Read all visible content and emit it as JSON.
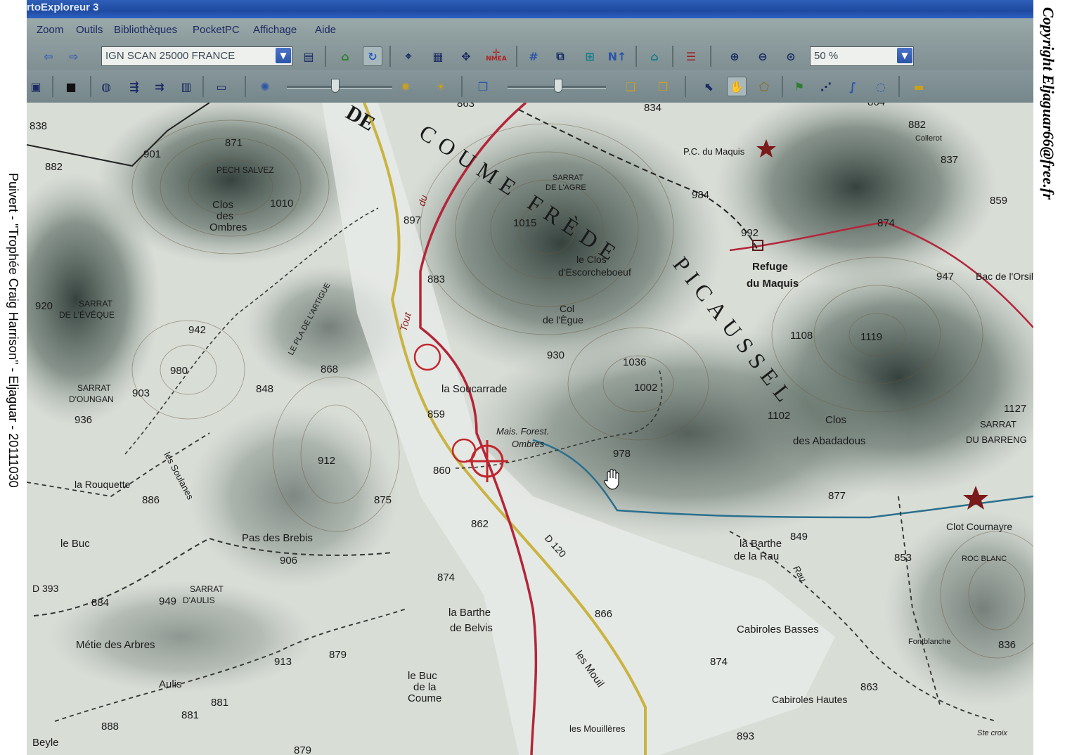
{
  "window": {
    "title": "rtoExploreur 3"
  },
  "menu": {
    "items": [
      "Zoom",
      "Outils",
      "Bibliothèques",
      "PocketPC",
      "Affichage",
      "Aide"
    ]
  },
  "toolbar": {
    "map_selector": {
      "value": "IGN SCAN 25000 FRANCE"
    },
    "zoom_selector": {
      "value": "50 %"
    },
    "nmea_label": "NMEA",
    "north_label": "N"
  },
  "map": {
    "big_labels": {
      "de": "DE",
      "coume_frede": "COUME FRÈDE",
      "picaussel": "PICAUSSEL"
    },
    "places": {
      "pech_salvee": "PECH SALVEZ",
      "clos_des_ombres": [
        "Clos",
        "des",
        "Ombres"
      ],
      "sarrat_eveque": [
        "SARRAT",
        "DE L'ÉVÊQUE"
      ],
      "pla_artigue": "LE PLA DE L'ARTIGUE",
      "sarrat_oungan": [
        "SARRAT",
        "D'OUNGAN"
      ],
      "la_soucarrade": "la Soucarrade",
      "maison_forestiere": [
        "Mais. Forest.",
        "Ombres"
      ],
      "la_rouquette": "la Rouquette",
      "le_buc": "le Buc",
      "pas_des_brebis": "Pas des Brebis",
      "sarrat_aulis": [
        "SARRAT",
        "D'AULIS"
      ],
      "metie_arbres": "Métie des Arbres",
      "aulis": "Aulis",
      "beyle": "Beyle",
      "les_soulanes": "les Soulanes",
      "barthe_belvis": [
        "la Barthe",
        "de Belvis"
      ],
      "buc_coume": [
        "le Buc",
        "de la",
        "Coume"
      ],
      "les_mouil": "les Mouil",
      "les_mouilleres": "les Mouillères",
      "clos_escorcheboeuf": [
        "le Clos",
        "d'Escorcheboeuf"
      ],
      "col_egue": [
        "Col",
        "de l'Ègue"
      ],
      "sarrat_agre": [
        "SARRAT",
        "DE L'AGRE"
      ],
      "pc_maquis": "P.C. du Maquis",
      "refuge": [
        "Refuge",
        "du Maquis"
      ],
      "clos_abadadous": [
        "Clos",
        "des Abadadous"
      ],
      "sarrat_barreng": [
        "SARRAT",
        "DU BARRENG"
      ],
      "barthe_rau": [
        "la Barthe",
        "de la Rau"
      ],
      "cabiroles_basses": "Cabiroles Basses",
      "cabiroles_hautes": "Cabiroles Hautes",
      "clot_cournayre": "Clot Cournayre",
      "roc_blanc": "ROC BLANC",
      "fontblanche": "Fontblanche",
      "collerot": "Collerot",
      "bac_orsille": "Bac de l'Orsille",
      "ste_croix": "Ste croix",
      "road_d120": "D 120",
      "road_d393": "D 393",
      "tout": "Tout",
      "du": "du",
      "rau": "Rau"
    },
    "elevations": [
      "838",
      "871",
      "863",
      "882",
      "901",
      "1010",
      "942",
      "920",
      "980",
      "903",
      "936",
      "848",
      "868",
      "897",
      "883",
      "859",
      "860",
      "875",
      "862",
      "874",
      "866",
      "912",
      "886",
      "906",
      "884",
      "949",
      "913",
      "879",
      "881",
      "888",
      "881",
      "879",
      "893",
      "874",
      "863",
      "877",
      "849",
      "853",
      "836",
      "1127",
      "1119",
      "1108",
      "1102",
      "1036",
      "1002",
      "930",
      "978",
      "1015",
      "992",
      "984",
      "864",
      "882",
      "837",
      "859",
      "874",
      "947",
      "834"
    ]
  },
  "annotations": {
    "left_caption": "Puivert - \"Trophée Craig Harrison\" - Eljaguar - 20111030",
    "right_caption": "Copyright Eljaguar66@free.fr"
  },
  "colors": {
    "toolbar": "#8d9c9e",
    "map_paper": "#dfe3df",
    "relief": "#4c5c55",
    "trail_red": "#b3263a",
    "road_yellow": "#c9b342",
    "forest_edge": "#2a6f8e"
  }
}
